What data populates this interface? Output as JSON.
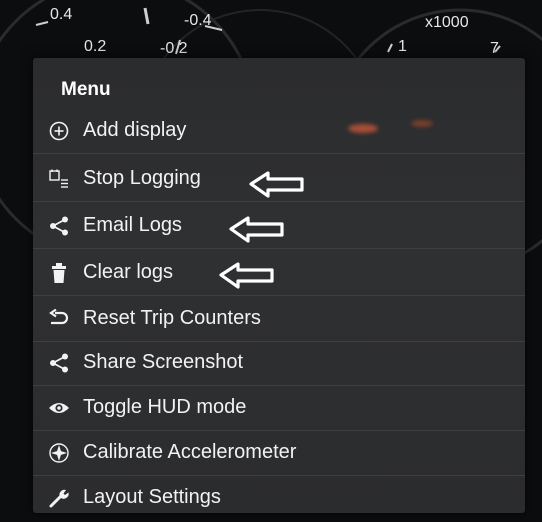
{
  "gauges": {
    "left_top": "0.4",
    "left_bottom": "0.2",
    "mid_top": "-0.4",
    "mid_bottom": "-0.2",
    "right_scale": "x1000",
    "right_tick_1": "1",
    "right_tick_7": "7"
  },
  "menu": {
    "title": "Menu",
    "items": [
      {
        "label": "Add display",
        "icon": "add-circle-icon"
      },
      {
        "label": "Stop Logging",
        "icon": "log-list-icon"
      },
      {
        "label": "Email Logs",
        "icon": "share-icon"
      },
      {
        "label": "Clear logs",
        "icon": "trash-icon"
      },
      {
        "label": "Reset Trip Counters",
        "icon": "undo-icon"
      },
      {
        "label": "Share Screenshot",
        "icon": "share-icon"
      },
      {
        "label": "Toggle HUD mode",
        "icon": "eye-icon"
      },
      {
        "label": "Calibrate Accelerometer",
        "icon": "compass-icon"
      },
      {
        "label": "Layout Settings",
        "icon": "wrench-icon"
      }
    ]
  },
  "colors": {
    "menu_bg": "#2d2e30",
    "text": "#f2f2f2",
    "arrow": "#ffffff",
    "divider": "#3e3f41"
  }
}
